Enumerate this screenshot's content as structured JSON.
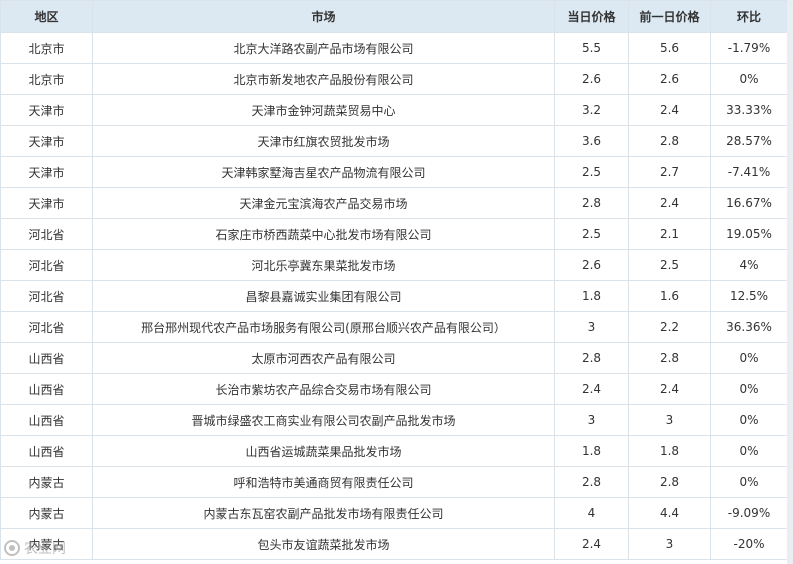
{
  "table": {
    "headers": [
      "地区",
      "市场",
      "当日价格",
      "前一日价格",
      "环比"
    ],
    "rows": [
      [
        "北京市",
        "北京大洋路农副产品市场有限公司",
        "5.5",
        "5.6",
        "-1.79%"
      ],
      [
        "北京市",
        "北京市新发地农产品股份有限公司",
        "2.6",
        "2.6",
        "0%"
      ],
      [
        "天津市",
        "天津市金钟河蔬菜贸易中心",
        "3.2",
        "2.4",
        "33.33%"
      ],
      [
        "天津市",
        "天津市红旗农贸批发市场",
        "3.6",
        "2.8",
        "28.57%"
      ],
      [
        "天津市",
        "天津韩家墅海吉星农产品物流有限公司",
        "2.5",
        "2.7",
        "-7.41%"
      ],
      [
        "天津市",
        "天津金元宝滨海农产品交易市场",
        "2.8",
        "2.4",
        "16.67%"
      ],
      [
        "河北省",
        "石家庄市桥西蔬菜中心批发市场有限公司",
        "2.5",
        "2.1",
        "19.05%"
      ],
      [
        "河北省",
        "河北乐亭冀东果菜批发市场",
        "2.6",
        "2.5",
        "4%"
      ],
      [
        "河北省",
        "昌黎县嘉诚实业集团有限公司",
        "1.8",
        "1.6",
        "12.5%"
      ],
      [
        "河北省",
        "邢台邢州现代农产品市场服务有限公司(原邢台顺兴农产品有限公司）",
        "3",
        "2.2",
        "36.36%"
      ],
      [
        "山西省",
        "太原市河西农产品有限公司",
        "2.8",
        "2.8",
        "0%"
      ],
      [
        "山西省",
        "长治市紫坊农产品综合交易市场有限公司",
        "2.4",
        "2.4",
        "0%"
      ],
      [
        "山西省",
        "晋城市绿盛农工商实业有限公司农副产品批发市场",
        "3",
        "3",
        "0%"
      ],
      [
        "山西省",
        "山西省运城蔬菜果品批发市场",
        "1.8",
        "1.8",
        "0%"
      ],
      [
        "内蒙古",
        "呼和浩特市美通商贸有限责任公司",
        "2.8",
        "2.8",
        "0%"
      ],
      [
        "内蒙古",
        "内蒙古东瓦窑农副产品批发市场有限责任公司",
        "4",
        "4.4",
        "-9.09%"
      ],
      [
        "内蒙古",
        "包头市友谊蔬菜批发市场",
        "2.4",
        "3",
        "-20%"
      ]
    ]
  },
  "watermark": {
    "text": "农业网",
    "icon": "watermark-logo-icon"
  }
}
